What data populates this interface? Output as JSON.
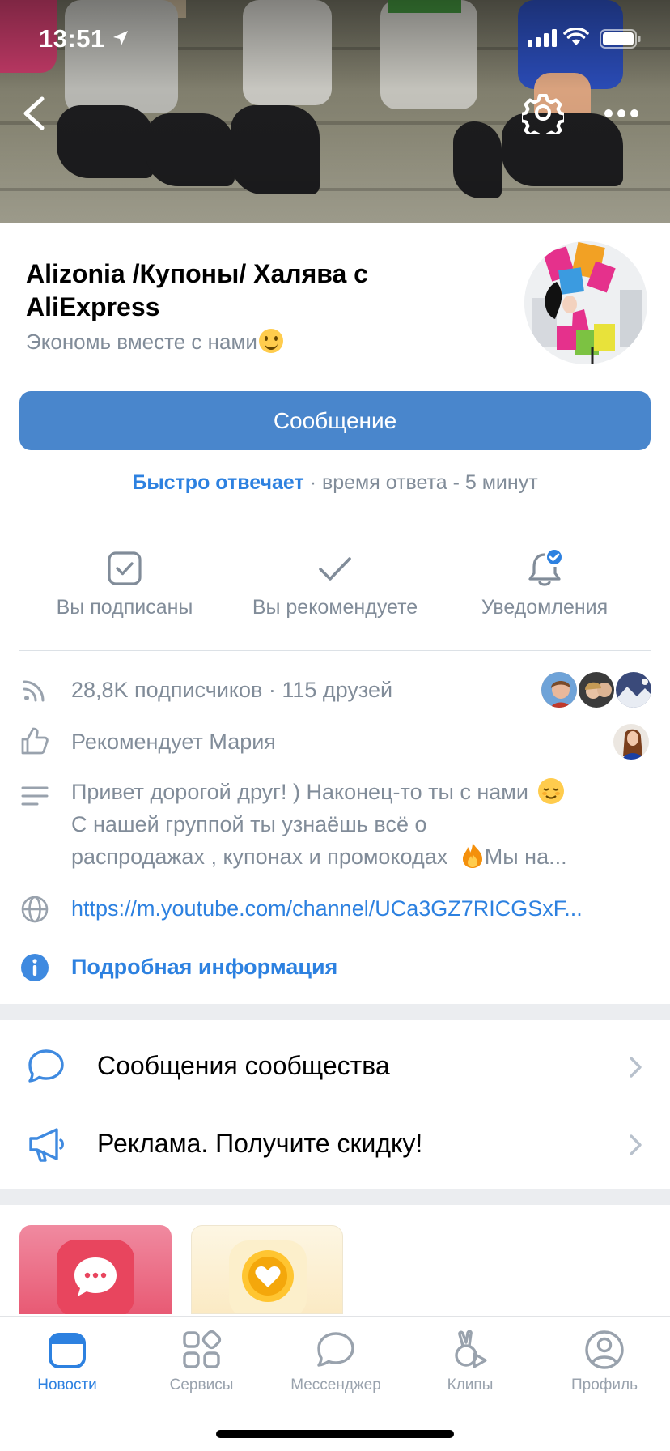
{
  "status_bar": {
    "time": "13:51"
  },
  "group": {
    "name": "Alizonia /Купоны/ Халява с AliExpress",
    "status": "Экономь вместе с нами"
  },
  "message_button": "Сообщение",
  "reply": {
    "fast": "Быстро отвечает",
    "rest": " · время ответа - 5 минут"
  },
  "actions": [
    {
      "label": "Вы подписаны",
      "icon": "subscribed-check-icon"
    },
    {
      "label": "Вы рекомендуете",
      "icon": "checkmark-icon"
    },
    {
      "label": "Уведомления",
      "icon": "bell-icon"
    }
  ],
  "info": {
    "followers": "28,8K подписчиков · 115 друзей",
    "recommends": "Рекомендует Мария",
    "description_lines": [
      "Привет дорогой друг! ) Наконец-то ты с нами",
      "С нашей группой ты узнаёшь всё о",
      "распродажах , купонах и промокодах",
      "Мы на..."
    ],
    "link": "https://m.youtube.com/channel/UCa3GZ7RICGSxF...",
    "details": "Подробная информация"
  },
  "menu": [
    {
      "label": "Сообщения сообщества",
      "icon": "chat-bubble-icon"
    },
    {
      "label": "Реклама. Получите скидку!",
      "icon": "megaphone-icon"
    }
  ],
  "tabs": [
    {
      "label": "Новости",
      "icon": "news-icon",
      "active": true
    },
    {
      "label": "Сервисы",
      "icon": "services-icon",
      "active": false
    },
    {
      "label": "Мессенджер",
      "icon": "messenger-icon",
      "active": false
    },
    {
      "label": "Клипы",
      "icon": "clips-icon",
      "active": false
    },
    {
      "label": "Профиль",
      "icon": "profile-icon",
      "active": false
    }
  ],
  "colors": {
    "accent": "#2d81e0",
    "button": "#4986cc",
    "secondary_text": "#818c99",
    "icon_gray": "#99a2ad",
    "separator": "#ebedf0"
  }
}
